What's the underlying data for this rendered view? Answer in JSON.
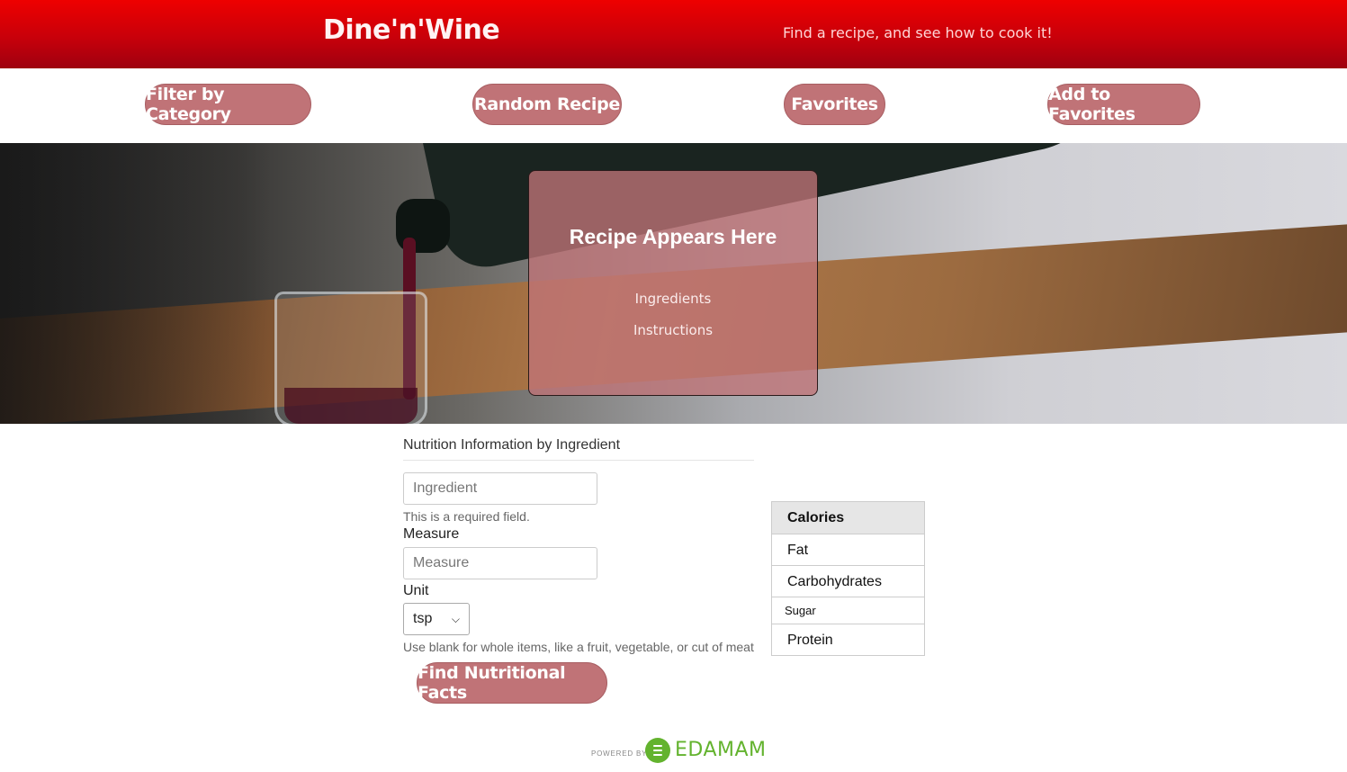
{
  "header": {
    "brand": "Dine'n'Wine",
    "tagline": "Find a recipe, and see how to cook it!"
  },
  "nav": {
    "filter_by_category": "Filter by Category",
    "random_recipe": "Random Recipe",
    "favorites": "Favorites",
    "add_to_favorites": "Add to Favorites"
  },
  "recipe_card": {
    "title": "Recipe Appears Here",
    "ingredients": "Ingredients",
    "instructions": "Instructions"
  },
  "nutrition_form": {
    "section_title": "Nutrition Information by Ingredient",
    "ingredient_placeholder": "Ingredient",
    "required_help": "This is a required field.",
    "measure_label": "Measure",
    "measure_placeholder": "Measure",
    "unit_label": "Unit",
    "unit_selected": "tsp",
    "unit_help": "Use blank for whole items, like a fruit, vegetable, or cut of meat",
    "submit_label": "Find Nutritional Facts"
  },
  "nutrition_table": {
    "calories": "Calories",
    "fat": "Fat",
    "carbohydrates": "Carbohydrates",
    "sugar": "Sugar",
    "protein": "Protein"
  },
  "footer": {
    "powered_by": "POWERED BY",
    "provider": "EDAMAM"
  },
  "colors": {
    "header_red": "#ee0000",
    "button_rose": "#c07377",
    "edamam_green": "#63b32e"
  }
}
